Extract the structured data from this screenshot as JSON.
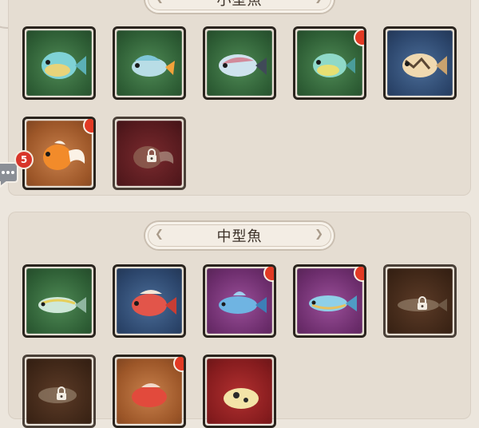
{
  "sections": [
    {
      "title": "小型魚"
    },
    {
      "title": "中型魚"
    }
  ],
  "side_badge": {
    "count": "5"
  },
  "colors": {
    "green": "#2e5e35",
    "blue": "#2c466c",
    "purple": "#6c2d6c",
    "orange": "#9c5628",
    "maroon": "#561a1e",
    "brown": "#3e2617",
    "red": "#861c1e",
    "new_dot": "#e23a24"
  },
  "small_fish_slots": [
    {
      "rarity": "green",
      "locked": false,
      "new": false
    },
    {
      "rarity": "green",
      "locked": false,
      "new": false
    },
    {
      "rarity": "green",
      "locked": false,
      "new": false
    },
    {
      "rarity": "green",
      "locked": false,
      "new": true
    },
    {
      "rarity": "blue",
      "locked": false,
      "new": false
    },
    {
      "rarity": "orange",
      "locked": false,
      "new": true
    },
    {
      "rarity": "maroon",
      "locked": true,
      "new": false
    }
  ],
  "medium_fish_slots": [
    {
      "rarity": "green",
      "locked": false,
      "new": false
    },
    {
      "rarity": "blue",
      "locked": false,
      "new": false
    },
    {
      "rarity": "purple",
      "locked": false,
      "new": true
    },
    {
      "rarity": "purple",
      "locked": false,
      "new": true
    },
    {
      "rarity": "brown",
      "locked": true,
      "new": false
    },
    {
      "rarity": "brown",
      "locked": true,
      "new": false
    },
    {
      "rarity": "orange",
      "locked": false,
      "new": true
    },
    {
      "rarity": "red",
      "locked": false,
      "new": false
    }
  ]
}
